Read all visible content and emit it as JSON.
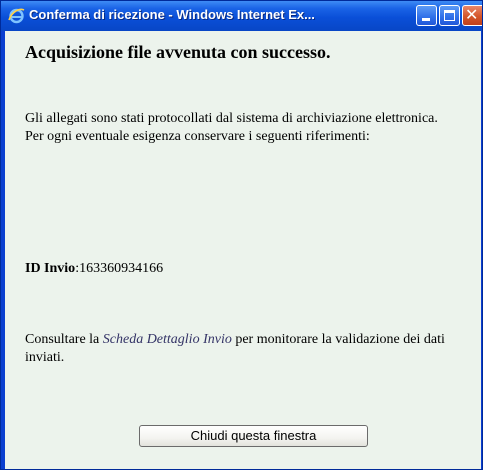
{
  "window": {
    "title": "Conferma di ricezione - Windows Internet Ex...",
    "icon": "ie-icon",
    "controls": [
      "minimize",
      "maximize",
      "close"
    ]
  },
  "content": {
    "heading": "Acquisizione file avvenuta con successo.",
    "paragraph1_line1": "Gli allegati sono stati protocollati dal sistema di archiviazione elettronica.",
    "paragraph1_line2": "Per ogni eventuale esigenza conservare i seguenti riferimenti:",
    "id_label": "ID Invio",
    "id_value": ":163360934166",
    "consult_prefix": "Consultare la ",
    "consult_link": "Scheda Dettaglio Invio",
    "consult_suffix": " per monitorare la validazione dei dati inviati."
  },
  "buttons": {
    "close_window": "Chiudi questa finestra"
  },
  "colors": {
    "titlebar": "#0a4fd8",
    "content_bg": "#ecf3ec",
    "close_button": "#d4562b"
  }
}
